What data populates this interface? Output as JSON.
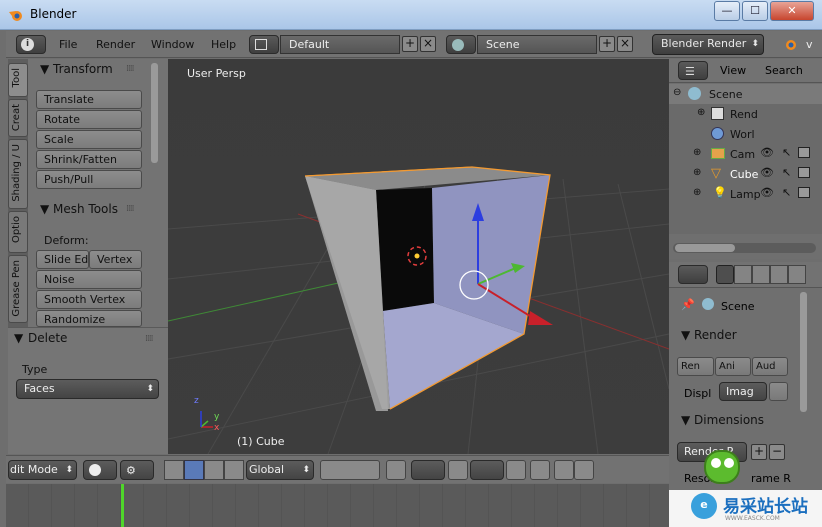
{
  "window": {
    "title": "Blender",
    "min": "—",
    "max": "☐",
    "close": "✕"
  },
  "menubar": {
    "info_icon": "i",
    "menus": [
      "File",
      "Render",
      "Window",
      "Help"
    ],
    "layout_field": "Default",
    "scene_field": "Scene",
    "render_engine": "Blender Render",
    "version_partial": "v"
  },
  "tool_tabs": [
    "Tool",
    "Creat",
    "Shading / U",
    "Optio",
    "Grease Pen"
  ],
  "tool_panel": {
    "transform_header": "Transform",
    "transform_buttons": [
      "Translate",
      "Rotate",
      "Scale",
      "Shrink/Fatten",
      "Push/Pull"
    ],
    "mesh_tools_header": "Mesh Tools",
    "deform_label": "Deform:",
    "slide_edge": "Slide Ed",
    "vertex": "Vertex",
    "mesh_buttons": [
      "Noise",
      "Smooth Vertex",
      "Randomize"
    ]
  },
  "operator_panel": {
    "header": "Delete",
    "type_label": "Type",
    "type_value": "Faces"
  },
  "viewport": {
    "view_name": "User Persp",
    "object_label": "(1) Cube",
    "axis_x": "x",
    "axis_y": "y",
    "axis_z": "z"
  },
  "outliner": {
    "view_menu": "View",
    "search_menu": "Search",
    "items": [
      {
        "label": "Scene",
        "indent": 0
      },
      {
        "label": "Rend",
        "indent": 1
      },
      {
        "label": "Worl",
        "indent": 1
      },
      {
        "label": "Cam",
        "indent": 1
      },
      {
        "label": "Cube",
        "indent": 1
      },
      {
        "label": "Lamp",
        "indent": 1
      }
    ]
  },
  "properties": {
    "breadcrumb": "Scene",
    "render_header": "Render",
    "render_btn": "Ren",
    "anim_btn": "Ani",
    "audio_btn": "Aud",
    "display_label": "Displ",
    "display_value": "Imag",
    "dimensions_header": "Dimensions",
    "preset_value": "Render P",
    "resolution_label": "Resol",
    "frame_rate_label": "rame R"
  },
  "bottom_bar": {
    "mode": "dit Mode",
    "orientation": "Global"
  },
  "watermark": {
    "text": "易采站长站",
    "sub": "WWW.EASCK.COM"
  },
  "colors": {
    "selection_orange": "#f39a32",
    "x_axis": "#c8202a",
    "y_axis": "#4db832",
    "z_axis": "#2c3ee0",
    "cube_face": "#9094c0"
  }
}
